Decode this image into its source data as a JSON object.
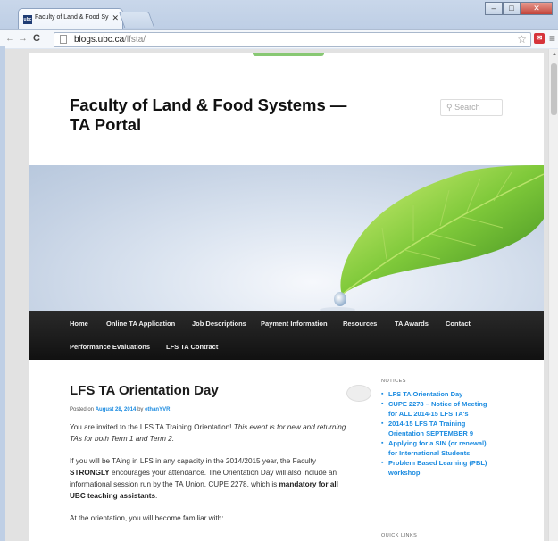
{
  "browser": {
    "tab_title": "Faculty of Land & Food Sy",
    "tab_favicon": "ubc",
    "url_host": "blogs.ubc.ca",
    "url_path": "/lfsta/"
  },
  "site": {
    "title": "Faculty of Land & Food Systems — TA Portal",
    "search_placeholder": "Search"
  },
  "nav": {
    "items": [
      "Home",
      "Online TA Application",
      "Job Descriptions",
      "Payment Information",
      "Resources",
      "TA Awards",
      "Contact",
      "Performance Evaluations",
      "LFS TA Contract"
    ]
  },
  "post": {
    "title": "LFS TA Orientation Day",
    "meta_prefix": "Posted on",
    "date": "August 28, 2014",
    "meta_by": "by",
    "author": "ethanYVR",
    "p1_a": "You are invited to the LFS TA Training Orientation! ",
    "p1_b": "This event is for new and returning TAs for both Term 1 and Term 2.",
    "p2_a": "If you will be TAing in LFS in any capacity in the 2014/2015 year, the Faculty ",
    "p2_b": "STRONGLY",
    "p2_c": " encourages your attendance. The Orientation Day will also include an informational session run by the TA Union, CUPE 2278, which is ",
    "p2_d": "mandatory for all UBC teaching assistants",
    "p2_e": ".",
    "p3": "At the orientation, you will become familiar with:"
  },
  "sidebar": {
    "notices_heading": "NOTICES",
    "notices": [
      "LFS TA Orientation Day",
      "CUPE 2278 – Notice of Meeting for ALL 2014-15 LFS TA's",
      "2014-15 LFS TA Training Orientation SEPTEMBER 9",
      "Applying for a SIN (or renewal) for International Students",
      "Problem Based Learning (PBL) workshop"
    ],
    "quick_links_heading": "QUICK LINKS"
  }
}
